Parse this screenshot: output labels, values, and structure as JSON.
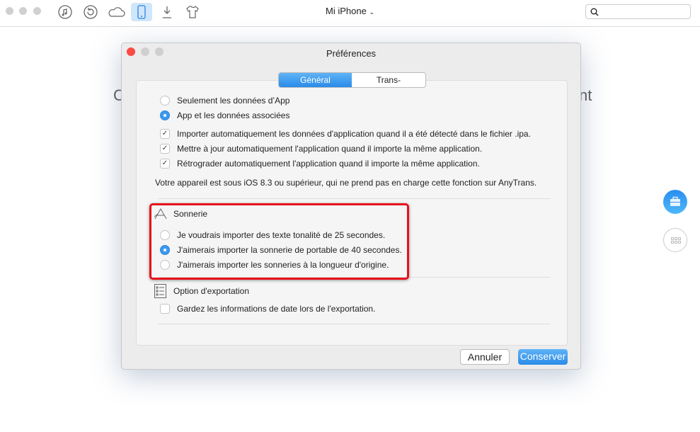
{
  "toolbar": {
    "title": "Mi iPhone",
    "icons": [
      "music-icon",
      "backup-restore-icon",
      "cloud-icon",
      "iphone-icon",
      "download-icon",
      "tshirt-icon"
    ],
    "search_placeholder": ""
  },
  "background": {
    "left_fragment": "C",
    "right_fragment": "nt"
  },
  "dialog": {
    "title": "Préférences",
    "tabs": [
      {
        "label": "Général",
        "active": true
      },
      {
        "label": "Trans-Coding",
        "active": false
      }
    ],
    "app_options": [
      {
        "label": "Seulement les données d’App",
        "selected": false
      },
      {
        "label": "App et les données associées",
        "selected": true
      }
    ],
    "app_checks": [
      {
        "label": "Importer automatiquement les données d'application quand il a été détecté dans le fichier .ipa.",
        "checked": true
      },
      {
        "label": "Mettre à jour automatiquement l'application quand il importe la même application.",
        "checked": true
      },
      {
        "label": "Rétrograder automatiquement l'application quand il importe la même application.",
        "checked": true
      }
    ],
    "ios_note": "Votre appareil est sous iOS 8.3 ou supérieur, qui ne prend pas en charge cette fonction sur AnyTrans.",
    "ringtone": {
      "heading": "Sonnerie",
      "options": [
        {
          "label": "Je voudrais importer des texte tonalité de 25 secondes.",
          "selected": false
        },
        {
          "label": "J'aimerais importer la sonnerie de portable de 40 secondes.",
          "selected": true
        },
        {
          "label": "J'aimerais importer les sonneries à la longueur d'origine.",
          "selected": false
        }
      ]
    },
    "export": {
      "heading": "Option d'exportation",
      "checks": [
        {
          "label": "Gardez les informations de date lors de l'exportation.",
          "checked": false
        }
      ]
    },
    "cancel_label": "Annuler",
    "save_label": "Conserver"
  },
  "colors": {
    "accent": "#3b99f0",
    "highlight": "#e8101a"
  }
}
